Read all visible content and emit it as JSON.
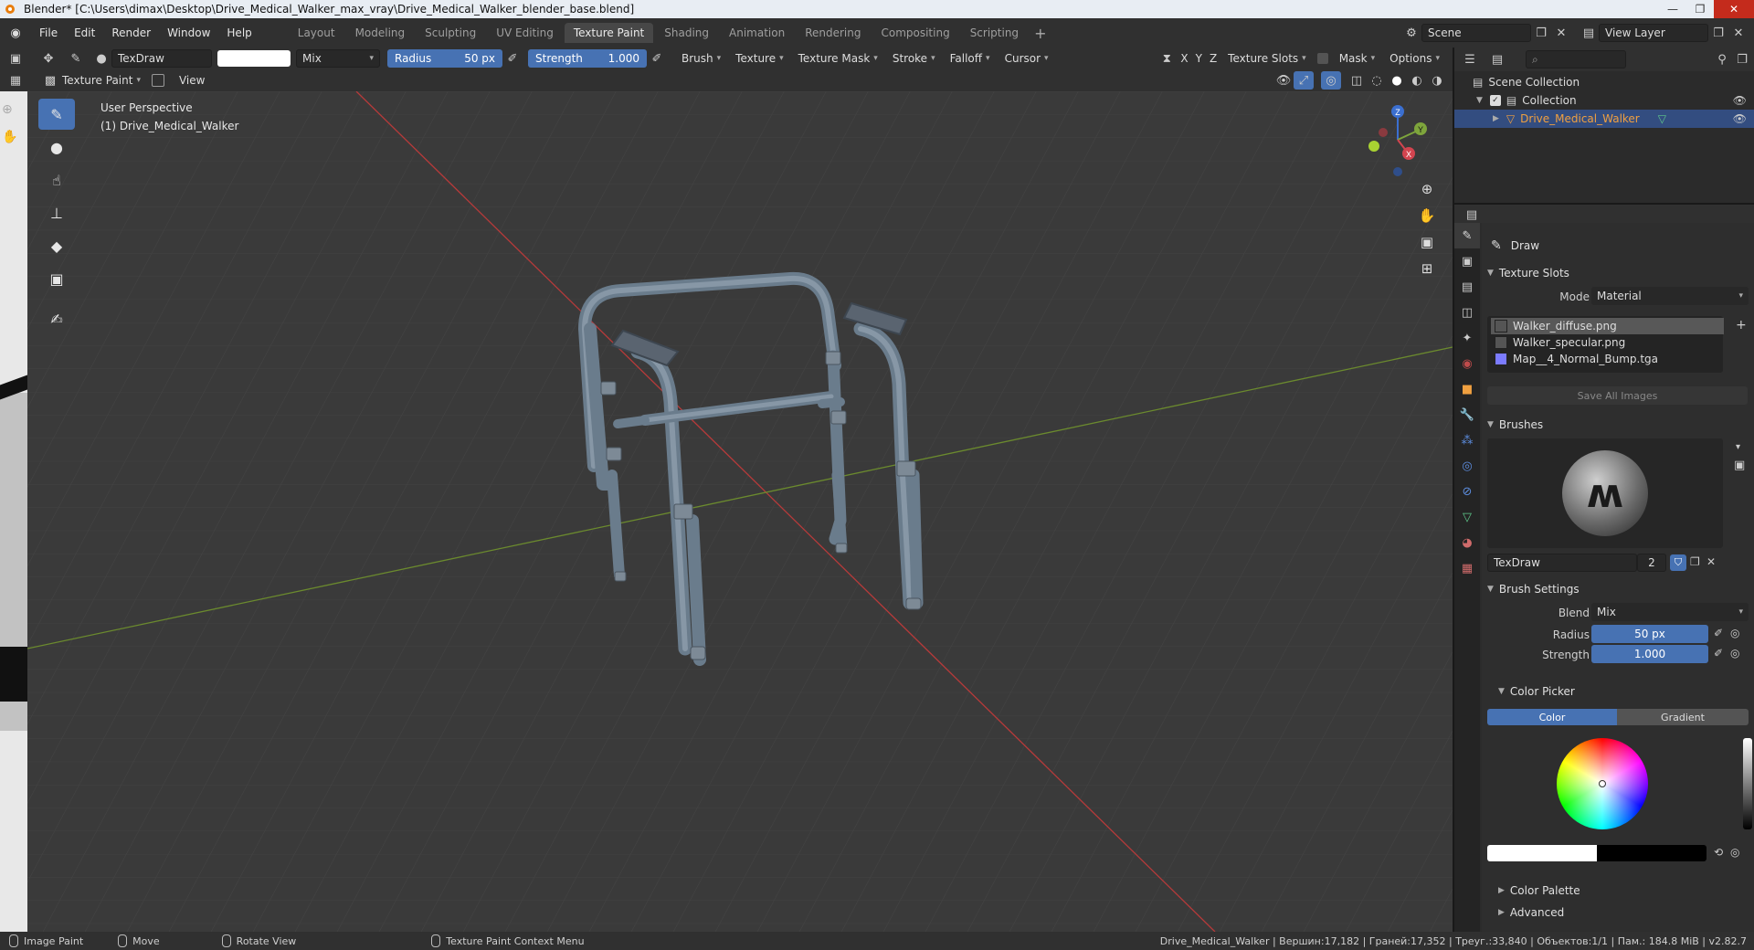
{
  "window": {
    "title": "Blender* [C:\\Users\\dimax\\Desktop\\Drive_Medical_Walker_max_vray\\Drive_Medical_Walker_blender_base.blend]",
    "minimize": "—",
    "restore": "❐",
    "close": "✕"
  },
  "menu": [
    "File",
    "Edit",
    "Render",
    "Window",
    "Help"
  ],
  "workspaces": [
    {
      "label": "Layout",
      "active": false
    },
    {
      "label": "Modeling",
      "active": false
    },
    {
      "label": "Sculpting",
      "active": false
    },
    {
      "label": "UV Editing",
      "active": false
    },
    {
      "label": "Texture Paint",
      "active": true
    },
    {
      "label": "Shading",
      "active": false
    },
    {
      "label": "Animation",
      "active": false
    },
    {
      "label": "Rendering",
      "active": false
    },
    {
      "label": "Compositing",
      "active": false
    },
    {
      "label": "Scripting",
      "active": false
    }
  ],
  "scene": {
    "name": "Scene",
    "view_layer": "View Layer"
  },
  "tool_header": {
    "brush_name": "TexDraw",
    "blend": "Mix",
    "radius_label": "Radius",
    "radius_value": "50 px",
    "strength_label": "Strength",
    "strength_value": "1.000",
    "menus": [
      "Brush",
      "Texture",
      "Texture Mask",
      "Stroke",
      "Falloff",
      "Cursor"
    ],
    "axes": [
      "X",
      "Y",
      "Z"
    ],
    "right_menus": [
      "Texture Slots",
      "Mask",
      "Options"
    ]
  },
  "view_header": {
    "mode": "Texture Paint",
    "view": "View"
  },
  "viewport": {
    "perspective": "User Perspective",
    "object": "(1) Drive_Medical_Walker",
    "gizmo": {
      "x": "X",
      "y": "Y",
      "z": "Z"
    }
  },
  "outliner": {
    "scene_collection": "Scene Collection",
    "collection": "Collection",
    "object": "Drive_Medical_Walker"
  },
  "properties": {
    "tool_name": "Draw",
    "texture_slots": {
      "title": "Texture Slots",
      "mode_label": "Mode",
      "mode_value": "Material",
      "slots": [
        "Walker_diffuse.png",
        "Walker_specular.png",
        "Map__4_Normal_Bump.tga"
      ],
      "save_all": "Save All Images"
    },
    "brushes": {
      "title": "Brushes",
      "brush_name": "TexDraw",
      "users": "2"
    },
    "brush_settings": {
      "title": "Brush Settings",
      "blend_label": "Blend",
      "blend_value": "Mix",
      "radius_label": "Radius",
      "radius_value": "50 px",
      "strength_label": "Strength",
      "strength_value": "1.000"
    },
    "color_picker": {
      "title": "Color Picker",
      "tab_color": "Color",
      "tab_gradient": "Gradient"
    },
    "color_palette": "Color Palette",
    "advanced": "Advanced"
  },
  "statusbar": {
    "items": [
      "Image Paint",
      "Move",
      "Rotate View",
      "Texture Paint Context Menu"
    ],
    "stats": "Drive_Medical_Walker | Вершин:17,182 | Граней:17,352 | Треуг.:33,840 | Объектов:1/1 | Пам.: 184.8 MiB | v2.82.7"
  },
  "colors": {
    "accent": "#4772b3",
    "selected_row": "#334d80",
    "background": "#3a3a3a"
  }
}
